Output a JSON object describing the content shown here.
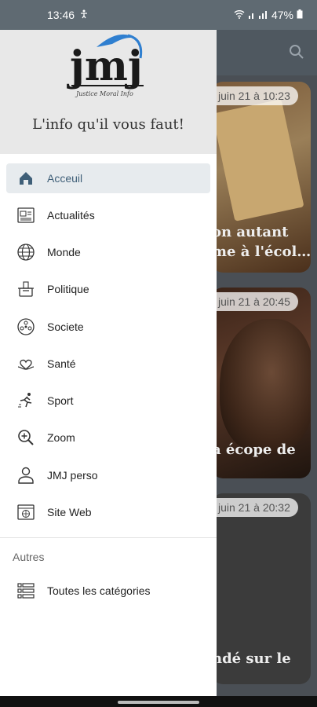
{
  "status_bar": {
    "time": "13:46",
    "battery": "47%"
  },
  "drawer": {
    "tagline": "L'info qu'il vous faut!",
    "logo_text": "jmj",
    "logo_subtitle": "Justice Moral Info",
    "items": [
      {
        "label": "Acceuil",
        "icon": "home-icon",
        "active": true
      },
      {
        "label": "Actualités",
        "icon": "newspaper-icon"
      },
      {
        "label": "Monde",
        "icon": "globe-icon"
      },
      {
        "label": "Politique",
        "icon": "ballot-box-icon"
      },
      {
        "label": "Societe",
        "icon": "society-icon"
      },
      {
        "label": "Santé",
        "icon": "health-icon"
      },
      {
        "label": "Sport",
        "icon": "runner-icon"
      },
      {
        "label": "Zoom",
        "icon": "zoom-icon"
      },
      {
        "label": "JMJ perso",
        "icon": "person-icon"
      },
      {
        "label": "Site Web",
        "icon": "web-icon"
      }
    ],
    "section_title": "Autres",
    "other_items": [
      {
        "label": "Toutes les catégories",
        "icon": "list-icon"
      }
    ]
  },
  "cards": [
    {
      "date": "juin 21 à 10:23",
      "title_line1": "on autant",
      "title_line2": "me à l'écol…"
    },
    {
      "date": "juin 21 à 20:45",
      "title_line1": "a écope de",
      "title_line2": ""
    },
    {
      "date": "juin 21 à 20:32",
      "title_line1": "ndé sur le",
      "title_line2": ""
    }
  ],
  "colors": {
    "accent": "#3f5f78",
    "status_bar": "#5f6a72",
    "active_bg": "#e7ebee"
  }
}
